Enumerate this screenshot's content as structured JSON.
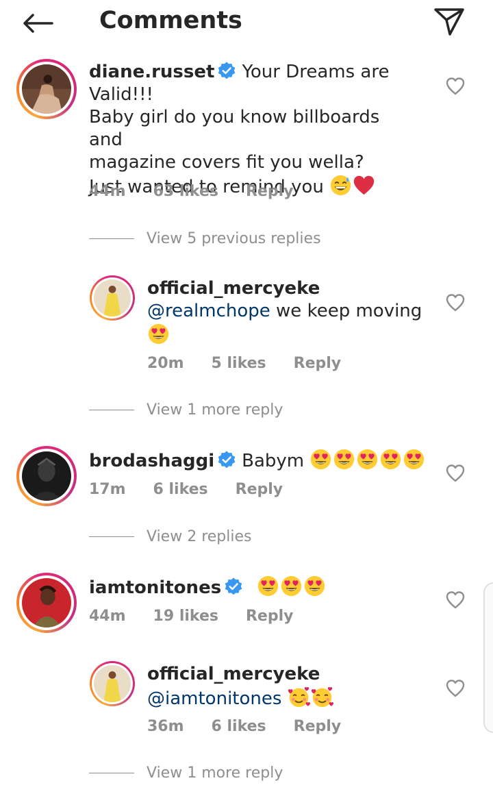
{
  "header": {
    "title": "Comments",
    "back_icon": "arrow-left-icon",
    "send_icon": "paper-plane-icon"
  },
  "comments": [
    {
      "username": "diane.russet",
      "verified": true,
      "text_first": "Your Dreams are",
      "text_lines": [
        "Valid!!!",
        "Baby girl do you know billboards and",
        "magazine covers fit you wella?",
        "Just wanted to remind you"
      ],
      "emojis_end": [
        "grinning-sweat-emoji",
        "red-heart-emoji"
      ],
      "time": "44m",
      "likes": "63 likes",
      "reply": "Reply"
    },
    {
      "view_replies": "View 5 previous replies"
    },
    {
      "username": "official_mercyeke",
      "mention": "@realmchope",
      "text": "we keep moving",
      "emojis": [
        "heart-eyes-emoji"
      ],
      "time": "20m",
      "likes": "5 likes",
      "reply": "Reply"
    },
    {
      "view_replies": "View 1 more reply"
    },
    {
      "username": "brodashaggi",
      "verified": true,
      "text": "Babym",
      "emojis": [
        "heart-eyes-emoji",
        "heart-eyes-emoji",
        "heart-eyes-emoji",
        "heart-eyes-emoji",
        "heart-eyes-emoji"
      ],
      "time": "17m",
      "likes": "6 likes",
      "reply": "Reply"
    },
    {
      "view_replies": "View 2 replies"
    },
    {
      "username": "iamtonitones",
      "verified": true,
      "emojis": [
        "heart-eyes-emoji",
        "heart-eyes-emoji",
        "heart-eyes-emoji"
      ],
      "time": "44m",
      "likes": "19 likes",
      "reply": "Reply"
    },
    {
      "username": "official_mercyeke",
      "mention": "@iamtonitones",
      "emojis": [
        "smiling-hearts-emoji",
        "smiling-hearts-emoji"
      ],
      "time": "36m",
      "likes": "6 likes",
      "reply": "Reply"
    },
    {
      "view_replies": "View 1 more reply"
    }
  ],
  "colors": {
    "text": "#262626",
    "meta": "#8e8e8e",
    "mention": "#00376b",
    "verified": "#3897f0"
  }
}
